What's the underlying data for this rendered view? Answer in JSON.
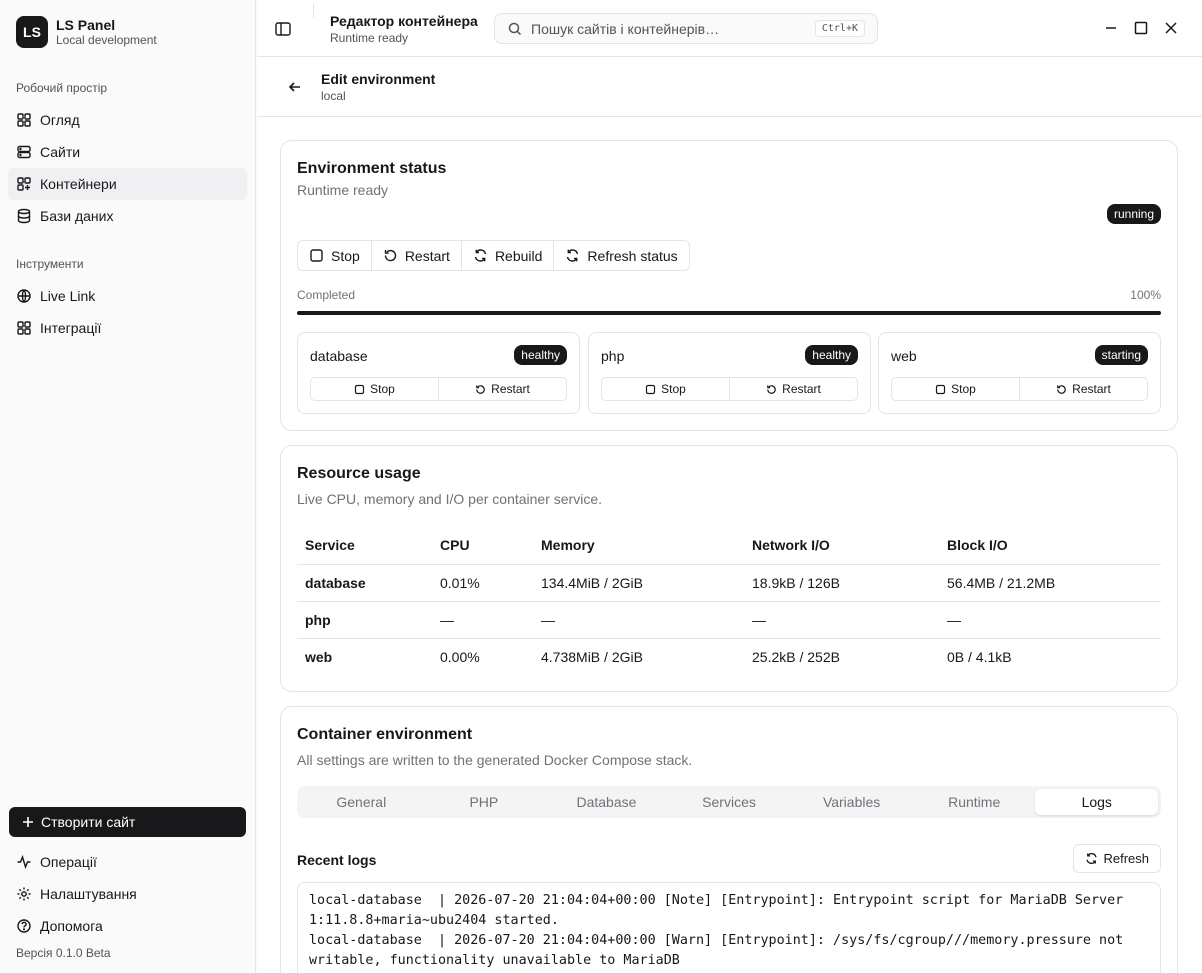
{
  "sidebar": {
    "brand": {
      "logo": "LS",
      "title": "LS Panel",
      "subtitle": "Local development"
    },
    "workspace_label": "Робочий простір",
    "workspace_items": [
      {
        "label": "Огляд",
        "icon": "layout-grid-icon"
      },
      {
        "label": "Сайти",
        "icon": "server-icon"
      },
      {
        "label": "Контейнери",
        "icon": "containers-icon",
        "active": true
      },
      {
        "label": "Бази даних",
        "icon": "database-icon"
      }
    ],
    "tools_label": "Інструменти",
    "tools_items": [
      {
        "label": "Live Link",
        "icon": "globe-icon"
      },
      {
        "label": "Інтеграції",
        "icon": "puzzle-grid-icon"
      }
    ],
    "create_site": "Створити сайт",
    "footer_items": [
      {
        "label": "Операції",
        "icon": "activity-icon"
      },
      {
        "label": "Налаштування",
        "icon": "gear-icon"
      },
      {
        "label": "Допомога",
        "icon": "help-circle-icon"
      }
    ],
    "version": "Версія 0.1.0 Beta"
  },
  "titlebar": {
    "title": "Редактор контейнера",
    "subtitle": "Runtime ready",
    "search_placeholder": "Пошук сайтів і контейнерів…",
    "shortcut": "Ctrl+K"
  },
  "page": {
    "title": "Edit environment",
    "subtitle": "local"
  },
  "status_card": {
    "title": "Environment status",
    "subtitle": "Runtime ready",
    "state": "running",
    "actions": {
      "stop": "Stop",
      "restart": "Restart",
      "rebuild": "Rebuild",
      "refresh": "Refresh status"
    },
    "progress_label": "Completed",
    "progress_text": "100%",
    "progress_value": 100,
    "services": [
      {
        "name": "database",
        "status": "healthy",
        "stop": "Stop",
        "restart": "Restart"
      },
      {
        "name": "php",
        "status": "healthy",
        "stop": "Stop",
        "restart": "Restart"
      },
      {
        "name": "web",
        "status": "starting",
        "stop": "Stop",
        "restart": "Restart"
      }
    ]
  },
  "resource_card": {
    "title": "Resource usage",
    "description": "Live CPU, memory and I/O per container service.",
    "columns": [
      "Service",
      "CPU",
      "Memory",
      "Network I/O",
      "Block I/O"
    ],
    "rows": [
      [
        "database",
        "0.01%",
        "134.4MiB / 2GiB",
        "18.9kB / 126B",
        "56.4MB / 21.2MB"
      ],
      [
        "php",
        "—",
        "—",
        "—",
        "—"
      ],
      [
        "web",
        "0.00%",
        "4.738MiB / 2GiB",
        "25.2kB / 252B",
        "0B / 4.1kB"
      ]
    ]
  },
  "env_card": {
    "title": "Container environment",
    "description": "All settings are written to the generated Docker Compose stack.",
    "tabs": [
      "General",
      "PHP",
      "Database",
      "Services",
      "Variables",
      "Runtime",
      "Logs"
    ],
    "active_tab": "Logs",
    "logs_title": "Recent logs",
    "refresh": "Refresh",
    "log_text": "local-database  | 2026-07-20 21:04:04+00:00 [Note] [Entrypoint]: Entrypoint script for MariaDB Server 1:11.8.8+maria~ubu2404 started.\nlocal-database  | 2026-07-20 21:04:04+00:00 [Warn] [Entrypoint]: /sys/fs/cgroup///memory.pressure not writable, functionality unavailable to MariaDB"
  }
}
